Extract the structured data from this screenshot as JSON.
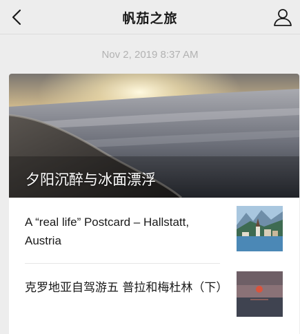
{
  "nav": {
    "title": "帆茄之旅",
    "back_icon": "chevron-left-icon",
    "profile_icon": "person-icon"
  },
  "timestamp": "Nov 2, 2019 8:37 AM",
  "article": {
    "cover_title": "夕阳沉醉与冰面漂浮",
    "items": [
      {
        "title": "A “real life” Postcard – Hallstatt, Austria"
      },
      {
        "title": "克罗地亚自驾游五  普拉和梅杜林（下）"
      }
    ]
  },
  "colors": {
    "background": "#ededed",
    "card": "#ffffff",
    "text": "#191919",
    "muted": "#b2b2b2"
  }
}
